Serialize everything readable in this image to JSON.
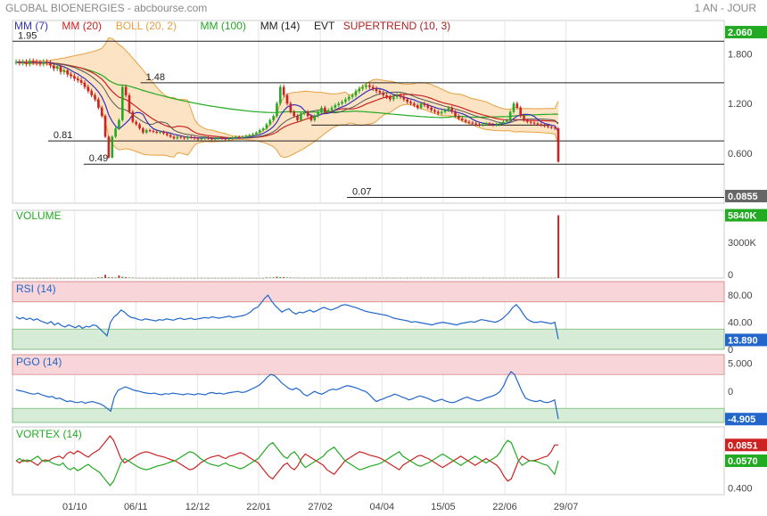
{
  "header": {
    "title": "GLOBAL BIOENERGIES - abcbourse.com",
    "period": "1 AN - JOUR"
  },
  "legend": [
    {
      "label": "MM (7)",
      "color": "#3333bb"
    },
    {
      "label": "MM (20)",
      "color": "#cc2222"
    },
    {
      "label": "BOLL (20, 2)",
      "color": "#e8a040"
    },
    {
      "label": "MM (100)",
      "color": "#22aa22"
    },
    {
      "label": "MM (14)",
      "color": "#222222"
    },
    {
      "label": "EVT",
      "color": "#222222"
    },
    {
      "label": "SUPERTREND (10, 3)",
      "color": "#aa2222"
    }
  ],
  "colors": {
    "up": "#22aa22",
    "down": "#cc2222",
    "boll_fill": "#fbe3c4",
    "boll_line": "#e8a040",
    "overbought": "#f8d5d8",
    "oversold": "#d6ecd6",
    "line_blue": "#2266cc",
    "vortex_pos": "#22aa22",
    "vortex_neg": "#cc2222"
  },
  "chart_data": [
    {
      "name": "price",
      "type": "candlestick",
      "ylim": [
        0,
        2.2
      ],
      "yticks": [
        0.6,
        1.2,
        1.8
      ],
      "ytick_labels": [
        "0.600",
        "1.200",
        "1.800"
      ],
      "level_badges": [
        {
          "value": 2.06,
          "label": "2.060",
          "color": "#22aa22"
        },
        {
          "value": 0.0855,
          "label": "0.0855",
          "color": "#666666"
        }
      ],
      "hlevels": [
        {
          "value": 1.95,
          "label": "1.95",
          "x_start": 0
        },
        {
          "value": 1.45,
          "label": "1.48",
          "x_start": 0.18
        },
        {
          "value": 0.94,
          "label": "",
          "x_start": 0.42,
          "x_end": 0.985
        },
        {
          "value": 0.75,
          "label": "0.81",
          "x_start": 0.05
        },
        {
          "value": 0.47,
          "label": "0.49",
          "x_start": 0.1
        },
        {
          "value": 0.07,
          "label": "0.07",
          "x_start": 0.47
        }
      ],
      "close": [
        1.7,
        1.69,
        1.7,
        1.68,
        1.71,
        1.7,
        1.69,
        1.68,
        1.7,
        1.69,
        1.66,
        1.62,
        1.65,
        1.58,
        1.6,
        1.55,
        1.53,
        1.5,
        1.48,
        1.45,
        1.4,
        1.35,
        1.3,
        1.25,
        1.15,
        1.05,
        0.8,
        0.55,
        0.8,
        0.9,
        1.0,
        1.4,
        1.3,
        1.1,
        0.98,
        0.95,
        0.9,
        0.85,
        0.88,
        0.87,
        0.86,
        0.85,
        0.86,
        0.84,
        0.82,
        0.8,
        0.78,
        0.8,
        0.79,
        0.78,
        0.8,
        0.79,
        0.78,
        0.77,
        0.78,
        0.79,
        0.78,
        0.77,
        0.78,
        0.79,
        0.78,
        0.77,
        0.78,
        0.79,
        0.8,
        0.79,
        0.8,
        0.81,
        0.82,
        0.83,
        0.85,
        0.88,
        0.9,
        0.95,
        1.0,
        1.05,
        1.2,
        1.4,
        1.3,
        1.2,
        1.1,
        1.05,
        1.0,
        1.08,
        1.1,
        1.05,
        1.0,
        1.05,
        1.1,
        1.15,
        1.1,
        1.12,
        1.15,
        1.18,
        1.2,
        1.22,
        1.25,
        1.28,
        1.3,
        1.35,
        1.38,
        1.4,
        1.42,
        1.4,
        1.38,
        1.35,
        1.33,
        1.3,
        1.28,
        1.25,
        1.28,
        1.3,
        1.28,
        1.25,
        1.22,
        1.2,
        1.18,
        1.15,
        1.2,
        1.18,
        1.15,
        1.12,
        1.1,
        1.08,
        1.1,
        1.12,
        1.15,
        1.1,
        1.05,
        1.02,
        1.0,
        0.98,
        0.97,
        0.96,
        0.95,
        0.94,
        0.95,
        0.96,
        0.95,
        0.94,
        0.95,
        0.96,
        0.98,
        1.0,
        1.1,
        1.2,
        1.15,
        1.05,
        1.0,
        0.98,
        0.97,
        0.96,
        0.95,
        0.94,
        0.93,
        0.92,
        0.91,
        0.9,
        0.5
      ]
    },
    {
      "name": "volume",
      "type": "bar",
      "title": "VOLUME",
      "ylim": [
        0,
        6300
      ],
      "yticks": [
        0,
        3000
      ],
      "ytick_labels": [
        "0",
        "3000K"
      ],
      "badge": {
        "value": 5840,
        "label": "5840K",
        "color": "#22aa22"
      },
      "values": [
        5,
        5,
        5,
        5,
        5,
        5,
        5,
        5,
        5,
        5,
        5,
        5,
        5,
        5,
        5,
        5,
        5,
        5,
        5,
        5,
        5,
        5,
        5,
        5,
        60,
        90,
        300,
        80,
        60,
        50,
        250,
        120,
        80,
        50,
        30,
        20,
        15,
        10,
        10,
        10,
        10,
        10,
        10,
        10,
        10,
        10,
        10,
        10,
        10,
        10,
        10,
        10,
        10,
        10,
        10,
        10,
        10,
        10,
        10,
        10,
        10,
        10,
        10,
        10,
        10,
        10,
        10,
        10,
        10,
        10,
        10,
        10,
        10,
        60,
        40,
        60,
        120,
        100,
        80,
        50,
        40,
        30,
        30,
        20,
        20,
        20,
        20,
        20,
        20,
        20,
        20,
        20,
        20,
        20,
        20,
        20,
        20,
        20,
        20,
        20,
        20,
        20,
        20,
        20,
        20,
        20,
        20,
        20,
        20,
        20,
        20,
        20,
        20,
        20,
        20,
        20,
        20,
        20,
        20,
        20,
        20,
        20,
        20,
        20,
        20,
        20,
        20,
        20,
        20,
        20,
        20,
        20,
        20,
        20,
        20,
        20,
        20,
        20,
        20,
        20,
        20,
        20,
        20,
        20,
        20,
        20,
        20,
        20,
        20,
        20,
        20,
        20,
        20,
        20,
        20,
        20,
        20,
        20,
        5840
      ]
    },
    {
      "name": "rsi",
      "type": "line",
      "title": "RSI (14)",
      "ylim": [
        0,
        100
      ],
      "overbought": 70,
      "oversold": 30,
      "yticks": [
        0,
        40,
        80
      ],
      "ytick_labels": [
        "0",
        "40.00",
        "80.00"
      ],
      "badge": {
        "value": 13.89,
        "label": "13.890",
        "color": "#2266cc"
      },
      "values": [
        48,
        45,
        47,
        44,
        46,
        43,
        45,
        42,
        40,
        38,
        41,
        36,
        39,
        35,
        33,
        36,
        34,
        32,
        35,
        31,
        34,
        33,
        36,
        35,
        30,
        25,
        20,
        40,
        48,
        52,
        58,
        55,
        50,
        47,
        46,
        44,
        43,
        45,
        44,
        43,
        42,
        44,
        43,
        45,
        44,
        43,
        45,
        46,
        44,
        45,
        46,
        44,
        45,
        46,
        47,
        46,
        48,
        47,
        46,
        47,
        48,
        49,
        47,
        48,
        49,
        50,
        52,
        55,
        60,
        62,
        68,
        75,
        80,
        72,
        65,
        60,
        55,
        58,
        60,
        55,
        52,
        55,
        54,
        56,
        58,
        55,
        57,
        60,
        62,
        60,
        58,
        60,
        62,
        65,
        66,
        65,
        63,
        62,
        60,
        58,
        56,
        55,
        54,
        53,
        52,
        51,
        50,
        48,
        46,
        45,
        44,
        43,
        42,
        40,
        41,
        40,
        39,
        38,
        37,
        36,
        38,
        39,
        40,
        39,
        38,
        37,
        36,
        38,
        39,
        40,
        41,
        40,
        42,
        44,
        43,
        42,
        41,
        40,
        42,
        45,
        50,
        55,
        62,
        66,
        60,
        52,
        45,
        42,
        40,
        40,
        41,
        40,
        39,
        38,
        40,
        15
      ]
    },
    {
      "name": "pgo",
      "type": "line",
      "title": "PGO (14)",
      "ylim": [
        -5.5,
        6.5
      ],
      "overbought": 3,
      "oversold": -3,
      "yticks": [
        0,
        5
      ],
      "ytick_labels": [
        "0",
        "5.000"
      ],
      "badge": {
        "value": -4.905,
        "label": "-4.905",
        "color": "#2266cc"
      },
      "values": [
        0.3,
        0.1,
        0.0,
        -0.2,
        -0.4,
        -0.5,
        -0.3,
        -0.6,
        -0.8,
        -1.0,
        -0.9,
        -1.3,
        -1.2,
        -1.5,
        -1.8,
        -1.7,
        -1.9,
        -2.0,
        -1.8,
        -2.1,
        -1.9,
        -1.8,
        -2.0,
        -2.2,
        -2.5,
        -3.0,
        -3.5,
        -1.0,
        0.2,
        0.5,
        0.8,
        0.6,
        0.3,
        0.1,
        0.0,
        -0.2,
        -0.3,
        -0.4,
        -0.3,
        -0.5,
        -0.6,
        -0.4,
        -0.5,
        -0.3,
        -0.4,
        -0.5,
        -0.6,
        -0.4,
        -0.5,
        -0.6,
        -0.4,
        -0.5,
        -0.6,
        -0.3,
        -0.2,
        -0.4,
        -0.3,
        -0.5,
        -0.3,
        -0.2,
        -0.1,
        0.0,
        -0.2,
        -0.1,
        0.2,
        0.5,
        0.8,
        1.2,
        1.8,
        2.5,
        3.0,
        2.8,
        2.2,
        1.5,
        1.0,
        0.5,
        0.3,
        0.6,
        0.2,
        -0.5,
        -0.8,
        -0.4,
        0.0,
        -0.3,
        -0.5,
        -0.2,
        0.2,
        0.4,
        0.3,
        0.5,
        0.8,
        1.0,
        0.9,
        0.7,
        0.5,
        0.2,
        0.0,
        -0.5,
        -1.2,
        -1.8,
        -1.5,
        -1.3,
        -1.0,
        -0.8,
        -0.5,
        -0.7,
        -1.0,
        -1.2,
        -1.5,
        -1.3,
        -1.0,
        -0.8,
        -1.0,
        -1.2,
        -1.5,
        -1.8,
        -1.6,
        -1.4,
        -1.7,
        -1.9,
        -2.0,
        -1.8,
        -1.5,
        -1.2,
        -1.0,
        -1.3,
        -1.5,
        -1.7,
        -1.5,
        -1.2,
        -1.0,
        -0.8,
        -0.5,
        0.0,
        1.0,
        2.5,
        3.5,
        3.0,
        1.5,
        0.0,
        -1.2,
        -1.5,
        -1.7,
        -1.8,
        -1.6,
        -1.9,
        -2.0,
        -1.8,
        -1.5,
        -4.9
      ]
    },
    {
      "name": "vortex",
      "type": "line",
      "title": "VORTEX (14)",
      "ylim": [
        0.25,
        1.75
      ],
      "yticks": [
        0.4
      ],
      "ytick_labels": [
        "0.400"
      ],
      "badges": [
        {
          "value": 1.35,
          "label": "0.0851",
          "color": "#cc2222"
        },
        {
          "value": 1.0,
          "label": "0.0570",
          "color": "#22aa22"
        }
      ],
      "plus": [
        1.0,
        1.05,
        0.98,
        1.02,
        1.0,
        1.05,
        1.1,
        1.02,
        0.98,
        1.0,
        0.95,
        0.92,
        0.9,
        0.95,
        0.85,
        0.8,
        0.85,
        0.78,
        0.82,
        0.88,
        0.92,
        0.85,
        0.8,
        0.75,
        0.65,
        0.55,
        0.45,
        0.55,
        0.75,
        0.95,
        1.05,
        1.0,
        0.95,
        0.9,
        0.85,
        0.82,
        0.8,
        0.82,
        0.85,
        0.88,
        0.9,
        0.92,
        0.95,
        0.98,
        1.0,
        1.05,
        1.1,
        1.15,
        1.2,
        1.18,
        1.12,
        1.05,
        1.0,
        0.95,
        0.92,
        0.9,
        0.88,
        0.92,
        0.95,
        0.9,
        0.88,
        0.85,
        0.82,
        0.85,
        0.9,
        0.95,
        1.0,
        1.05,
        1.15,
        1.25,
        1.35,
        1.4,
        1.3,
        1.2,
        1.1,
        1.05,
        1.15,
        1.2,
        1.1,
        0.95,
        0.85,
        0.9,
        0.95,
        1.0,
        1.05,
        1.1,
        1.2,
        1.25,
        1.3,
        1.2,
        1.1,
        1.0,
        0.95,
        0.9,
        0.85,
        0.8,
        0.82,
        0.85,
        0.88,
        0.9,
        0.92,
        0.95,
        1.0,
        1.05,
        1.1,
        1.15,
        1.2,
        1.1,
        1.05,
        1.0,
        0.95,
        0.9,
        0.88,
        0.92,
        0.95,
        1.0,
        1.05,
        1.1,
        1.15,
        1.1,
        1.05,
        1.0,
        0.95,
        0.9,
        0.95,
        1.0,
        1.05,
        1.1,
        1.05,
        1.0,
        0.95,
        1.0,
        1.05,
        1.1,
        1.2,
        1.35,
        1.45,
        1.4,
        1.2,
        1.0,
        0.9,
        0.95,
        1.0,
        1.0,
        0.98,
        0.95,
        0.92,
        0.9,
        0.8,
        0.7,
        1.0
      ],
      "minus": [
        1.0,
        0.95,
        1.02,
        0.98,
        1.0,
        0.95,
        0.9,
        0.98,
        1.02,
        1.0,
        1.05,
        1.08,
        1.1,
        1.05,
        1.15,
        1.2,
        1.15,
        1.22,
        1.18,
        1.12,
        1.08,
        1.15,
        1.2,
        1.25,
        1.35,
        1.45,
        1.55,
        1.45,
        1.25,
        1.05,
        0.95,
        1.0,
        1.05,
        1.1,
        1.15,
        1.18,
        1.2,
        1.18,
        1.15,
        1.12,
        1.1,
        1.08,
        1.05,
        1.02,
        1.0,
        0.95,
        0.9,
        0.85,
        0.8,
        0.82,
        0.88,
        0.95,
        1.0,
        1.05,
        1.08,
        1.1,
        1.12,
        1.08,
        1.05,
        1.1,
        1.12,
        1.15,
        1.18,
        1.15,
        1.1,
        1.05,
        1.0,
        0.95,
        0.85,
        0.75,
        0.65,
        0.6,
        0.7,
        0.8,
        0.9,
        0.95,
        0.85,
        0.8,
        0.9,
        1.05,
        1.15,
        1.1,
        1.05,
        1.0,
        0.95,
        0.9,
        0.8,
        0.75,
        0.7,
        0.8,
        0.9,
        1.0,
        1.05,
        1.1,
        1.15,
        1.2,
        1.18,
        1.15,
        1.12,
        1.1,
        1.08,
        1.05,
        1.0,
        0.95,
        0.9,
        0.85,
        0.8,
        0.9,
        0.95,
        1.0,
        1.05,
        1.1,
        1.12,
        1.08,
        1.05,
        1.0,
        0.95,
        0.9,
        0.85,
        0.9,
        0.95,
        1.0,
        1.05,
        1.1,
        1.05,
        1.0,
        0.95,
        0.9,
        0.95,
        1.0,
        1.05,
        1.0,
        0.95,
        0.9,
        0.8,
        0.65,
        0.55,
        0.6,
        0.8,
        1.0,
        1.1,
        1.05,
        1.0,
        1.0,
        1.02,
        1.05,
        1.08,
        1.1,
        1.2,
        1.35,
        1.35
      ]
    }
  ],
  "x_axis": {
    "labels": [
      "01/10",
      "06/11",
      "12/12",
      "22/01",
      "27/02",
      "04/04",
      "15/05",
      "22/06",
      "29/07"
    ],
    "positions": [
      0.114,
      0.226,
      0.339,
      0.451,
      0.564,
      0.677,
      0.789,
      0.902,
      1.014
    ]
  }
}
